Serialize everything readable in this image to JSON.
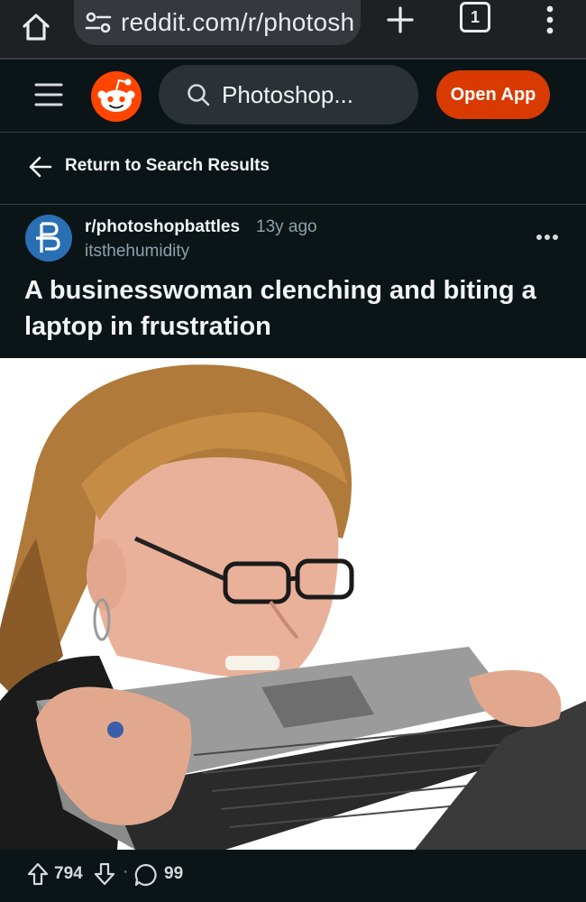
{
  "browser": {
    "url": "reddit.com/r/photosh",
    "tab_count": "1"
  },
  "header": {
    "search_text": "Photoshop...",
    "open_app_label": "Open App"
  },
  "nav": {
    "return_label": "Return to Search Results"
  },
  "post": {
    "subreddit": "r/photoshopbattles",
    "age": "13y ago",
    "author": "itsthehumidity",
    "title": "A businesswoman clenching and biting a laptop in frustration",
    "score": "794",
    "separator": "·",
    "comments": "99"
  },
  "colors": {
    "background": "#0b1416",
    "accent": "#d93a00",
    "reddit_orange": "#ff4500",
    "search_bg": "#2a3236"
  }
}
